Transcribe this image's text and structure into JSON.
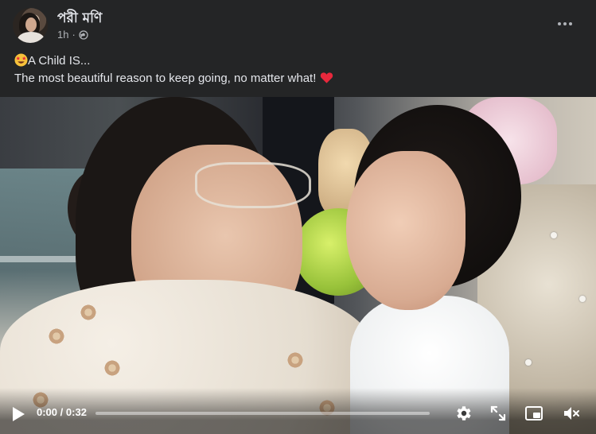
{
  "post": {
    "author_name": "পরী মণি",
    "time_ago": "1h",
    "separator": "·",
    "privacy_icon": "globe-icon",
    "more_icon": "more-dots-icon"
  },
  "caption": {
    "line1_emoji": "star-struck-emoji",
    "line1_text": "A Child IS...",
    "line2_text": "The most beautiful reason to keep going, no matter what!",
    "line2_emoji": "red-heart-emoji"
  },
  "video": {
    "current_time": "0:00",
    "time_separator": "/",
    "duration": "0:32",
    "progress_fraction": 0,
    "controls": {
      "play_icon": "play-icon",
      "settings_icon": "gear-icon",
      "fullscreen_icon": "expand-icon",
      "pip_icon": "picture-in-picture-icon",
      "mute_icon": "speaker-muted-icon"
    }
  },
  "colors": {
    "background": "#242526",
    "text_primary": "#e4e6eb",
    "text_secondary": "#b0b3b8",
    "heart": "#e8283c"
  }
}
